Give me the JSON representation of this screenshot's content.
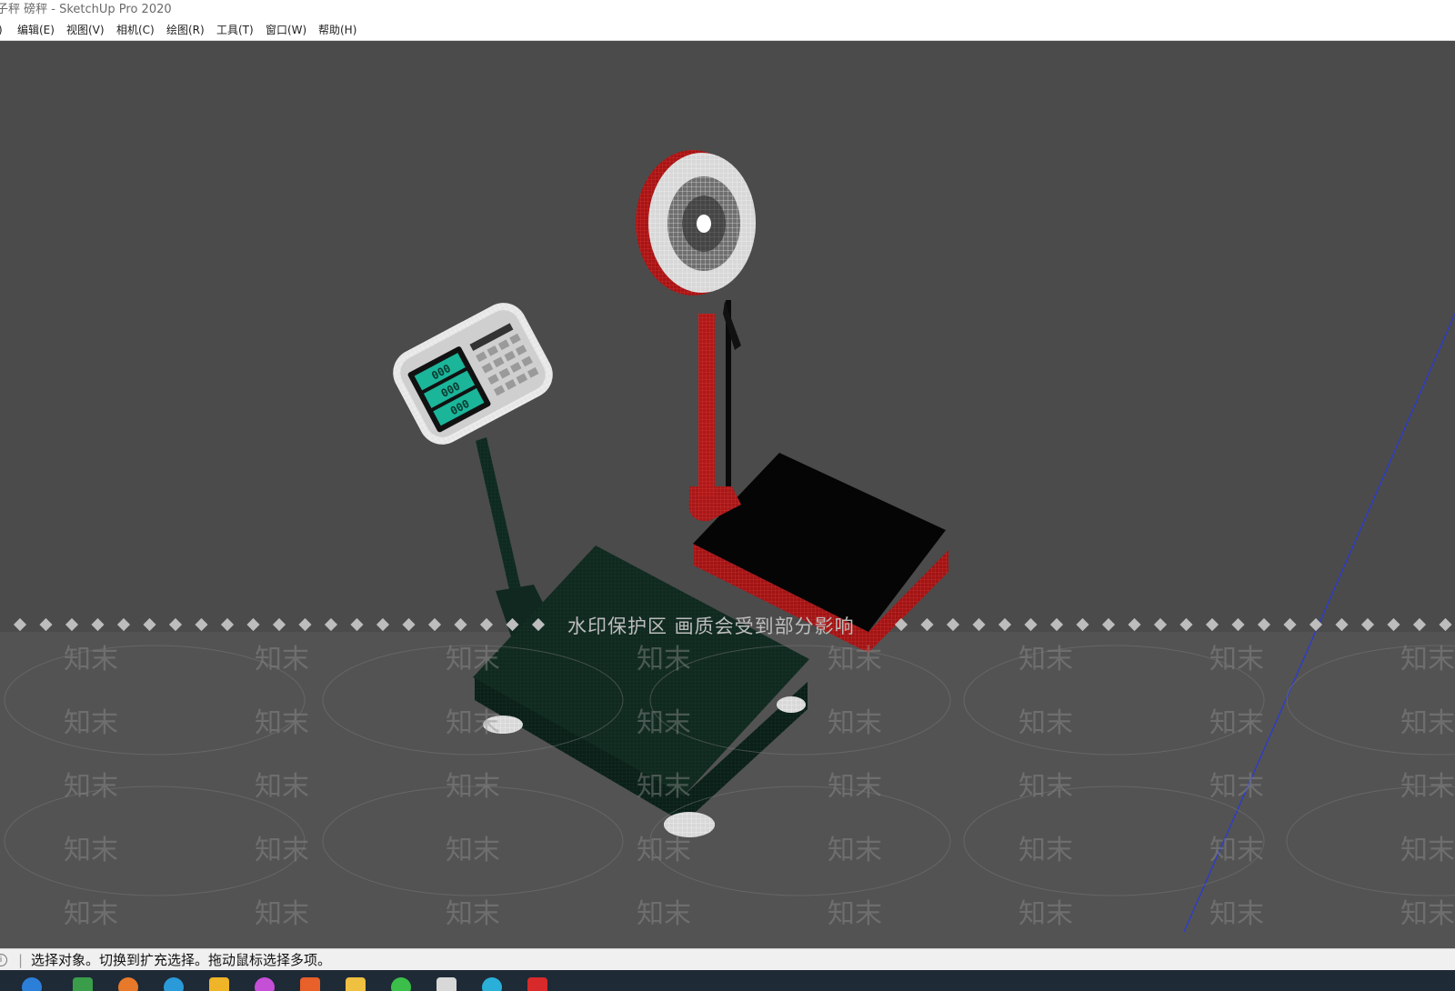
{
  "window": {
    "title": "子秤 磅秤 - SketchUp Pro 2020"
  },
  "menubar": {
    "items": [
      {
        "label": ")"
      },
      {
        "label": "编辑(E)"
      },
      {
        "label": "视图(V)"
      },
      {
        "label": "相机(C)"
      },
      {
        "label": "绘图(R)"
      },
      {
        "label": "工具(T)"
      },
      {
        "label": "窗口(W)"
      },
      {
        "label": "帮助(H)"
      }
    ]
  },
  "viewport": {
    "watermark_notice": "水印保护区   画质会受到部分影响",
    "watermark_text": "知末",
    "display_readout": {
      "line1": "000",
      "line2": "000",
      "line3": "000"
    }
  },
  "statusbar": {
    "icon": "info-icon",
    "message": "选择对象。切换到扩充选择。拖动鼠标选择多项。"
  },
  "taskbar": {
    "icons": [
      "browser-icon",
      "image-icon",
      "orange-app-icon",
      "blue-app-icon",
      "folder-app-icon",
      "color-app-icon",
      "office-app-icon",
      "file-explorer-icon",
      "wechat-icon",
      "sketchup-icon",
      "edge-icon",
      "pdf-icon"
    ]
  },
  "colors": {
    "viewport_bg": "#4b4b4b",
    "scale_green": "#0f2a20",
    "scale_red": "#b01818",
    "display_teal": "#1bb59a",
    "axis_blue": "#2b3bd0"
  }
}
